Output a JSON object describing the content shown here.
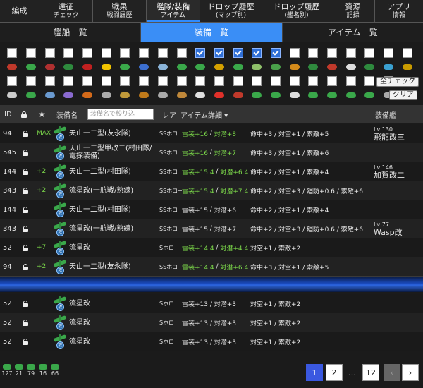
{
  "nav": {
    "items": [
      {
        "label": "編成",
        "sub": ""
      },
      {
        "label": "遠征",
        "sub": "チェック"
      },
      {
        "label": "戦果",
        "sub": "戦闘履歴"
      },
      {
        "label": "艦隊/装備",
        "sub": "アイテム"
      },
      {
        "label": "ドロップ履歴",
        "sub": "(マップ別)"
      },
      {
        "label": "ドロップ履歴",
        "sub": "(艦名別)"
      },
      {
        "label": "資源",
        "sub": "記録"
      },
      {
        "label": "アプリ",
        "sub": "情報"
      }
    ],
    "active_index": 3
  },
  "tabs": [
    {
      "label": "艦船一覧"
    },
    {
      "label": "装備一覧"
    },
    {
      "label": "アイテム一覧"
    }
  ],
  "filters": {
    "row1_checked": [
      false,
      false,
      false,
      false,
      false,
      false,
      false,
      false,
      false,
      false,
      true,
      true,
      true,
      true,
      true,
      false,
      false,
      false,
      false,
      false,
      false,
      false
    ],
    "row1_colors": [
      "#c0392b",
      "#3aa84a",
      "#b03030",
      "#2e8a3e",
      "#c02020",
      "#f2c400",
      "#3aa84a",
      "#3c6fd0",
      "#8ab3d8",
      "#3aa84a",
      "#3aa84a",
      "#d4a000",
      "#3aa84a",
      "#8fc06a",
      "#4aa04a",
      "#d48a1a",
      "#2f8a3e",
      "#c0392b",
      "#ddd",
      "#2e8a3e",
      "#3aa0d0",
      "#c99b00"
    ],
    "row2_colors": [
      "#ccc",
      "#3aa84a",
      "#6a9ad0",
      "#8a6ad0",
      "#d46a1a",
      "#aaa",
      "#c09a3a",
      "#c07a1a",
      "#aaa",
      "#c0883a",
      "#e0e0e0",
      "#e0302a",
      "#c0392b",
      "#3aa84a",
      "#3aa84a",
      "#ddd",
      "#3aa84a",
      "#3aa84a",
      "#3aa84a",
      "#3aa84a",
      "#aaa"
    ],
    "all_check_label": "全チェック",
    "clear_label": "クリア"
  },
  "table": {
    "headers": {
      "id": "ID",
      "name": "装備名",
      "search_placeholder": "装備名で絞り込",
      "rarity": "レア",
      "detail": "アイテム詳細 ▾",
      "ship": "装備艦"
    },
    "rows": [
      {
        "id": "94",
        "level": "MAX",
        "name": "天山一二型(友永隊)",
        "rarity": "SSホロ",
        "stat_a": "雷装+16",
        "stat_b": "対潜+8",
        "stat_c": "命中+3 / 対空+1 / 索敵+5",
        "ship_lv": "Lv 130",
        "ship": "飛龍改三"
      },
      {
        "id": "545",
        "level": "",
        "name": "天山一二型甲改二(村田隊/電探装備)",
        "rarity": "SSホロ",
        "stat_a": "雷装+16",
        "stat_b": "対潜+7",
        "stat_c": "命中+3 / 対空+1 / 索敵+6",
        "ship_lv": "",
        "ship": ""
      },
      {
        "id": "144",
        "level": "+2",
        "name": "天山一二型(村田隊)",
        "rarity": "SSホロ",
        "stat_a": "雷装+15.4",
        "stat_b": "対潜+6.4",
        "stat_c": "命中+2 / 対空+1 / 索敵+4",
        "ship_lv": "Lv 146",
        "ship": "加賀改二"
      },
      {
        "id": "343",
        "level": "+2",
        "name": "流星改(一航戦/熟練)",
        "rarity": "SSホロ+",
        "stat_a": "雷装+15.4",
        "stat_b": "対潜+7.4",
        "stat_c": "命中+2 / 対空+3 / 廻防+0.6 / 索敵+6",
        "ship_lv": "",
        "ship": ""
      },
      {
        "id": "144",
        "level": "",
        "name": "天山一二型(村田隊)",
        "rarity": "SSホロ",
        "stat_a": "雷装+15",
        "stat_b": "対潜+6",
        "stat_c": "命中+2 / 対空+1 / 索敵+4",
        "ship_lv": "",
        "ship": ""
      },
      {
        "id": "343",
        "level": "",
        "name": "流星改(一航戦/熟練)",
        "rarity": "SSホロ+",
        "stat_a": "雷装+15",
        "stat_b": "対潜+7",
        "stat_c": "命中+2 / 対空+3 / 廻防+0.6 / 索敵+6",
        "ship_lv": "Lv 77",
        "ship": "Wasp改"
      },
      {
        "id": "52",
        "level": "+7",
        "name": "流星改",
        "rarity": "Sホロ",
        "stat_a": "雷装+14.4",
        "stat_b": "対潜+4.4",
        "stat_c": "対空+1 / 索敵+2",
        "ship_lv": "",
        "ship": ""
      },
      {
        "id": "94",
        "level": "+2",
        "name": "天山一二型(友永隊)",
        "rarity": "SSホロ",
        "stat_a": "雷装+14.4",
        "stat_b": "対潜+6.4",
        "stat_c": "命中+3 / 対空+1 / 索敵+5",
        "ship_lv": "",
        "ship": ""
      },
      {
        "id": "52",
        "level": "",
        "name": "流星改",
        "rarity": "Sホロ",
        "stat_a": "雷装+13 / 対潜+3",
        "stat_b": "",
        "stat_c": "対空+1 / 索敵+2",
        "ship_lv": "",
        "ship": ""
      },
      {
        "id": "52",
        "level": "",
        "name": "流星改",
        "rarity": "Sホロ",
        "stat_a": "雷装+13 / 対潜+3",
        "stat_b": "",
        "stat_c": "対空+1 / 索敵+2",
        "ship_lv": "",
        "ship": ""
      },
      {
        "id": "52",
        "level": "",
        "name": "流星改",
        "rarity": "Sホロ",
        "stat_a": "雷装+13 / 対潜+3",
        "stat_b": "",
        "stat_c": "対空+1 / 索敵+2",
        "ship_lv": "",
        "ship": ""
      }
    ],
    "badge_label": "攻",
    "green_stats_rows": [
      0,
      1,
      2,
      3,
      6,
      7
    ]
  },
  "summary": [
    "127",
    "21",
    "79",
    "16",
    "66"
  ],
  "pagination": {
    "pages": [
      "1",
      "2",
      "…",
      "12"
    ],
    "active": "1",
    "prev": "‹",
    "next": "›"
  }
}
